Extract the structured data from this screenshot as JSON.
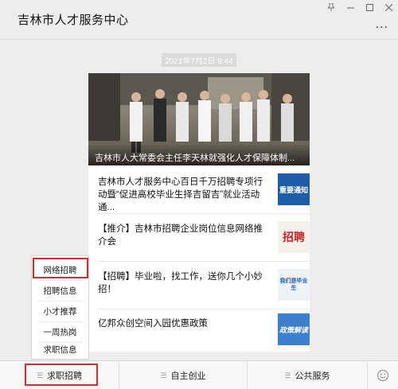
{
  "window": {
    "pin_icon": "pin-icon",
    "minimize_icon": "minimize-icon",
    "maximize_icon": "maximize-icon",
    "close_icon": "close-icon"
  },
  "header": {
    "title": "吉林市人才服务中心",
    "more_label": "..."
  },
  "message": {
    "timestamp": "2021年7月2日 9:44",
    "hero_caption": "吉林市人大常委会主任李天林就强化人才保障体制...",
    "items": [
      {
        "title": "吉林市人才服务中心百日千万招聘专项行动暨“促进高校毕业生择吉留吉”就业活动通...",
        "thumb_text": "重要通知"
      },
      {
        "title": "【推介】吉林市招聘企业岗位信息网络推介会",
        "thumb_text": "招聘"
      },
      {
        "title": "【招聘】毕业啦，找工作，送你几个小妙招！",
        "thumb_text": "我们是毕业生"
      },
      {
        "title": "亿邦众创空间入园优惠政策",
        "thumb_text": "政策解读"
      }
    ]
  },
  "popup_menu": {
    "items": [
      "网络招聘",
      "招聘信息",
      "小才推荐",
      "一周热岗",
      "求职信息"
    ]
  },
  "bottom_tabs": {
    "tab1": "求职招聘",
    "tab2": "自主创业",
    "tab3": "公共服务",
    "emoji_icon": "emoji-icon"
  },
  "colors": {
    "highlight": "#d92b2b",
    "background": "#ededed",
    "thumb_blue": "#1e5ea8"
  }
}
